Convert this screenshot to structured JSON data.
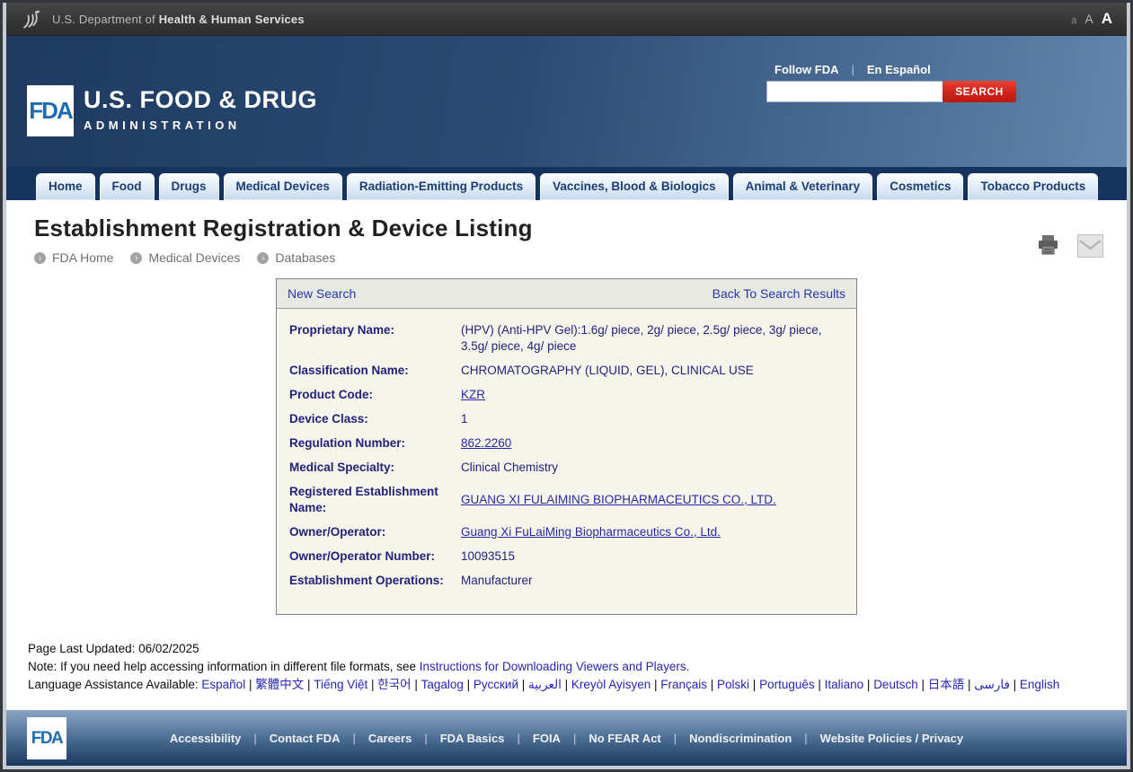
{
  "hhs_bar": {
    "dept_prefix": "U.S. Department of",
    "dept_bold": "Health & Human Services",
    "font_size_controls": [
      "a",
      "A",
      "A"
    ]
  },
  "header": {
    "logo_text": "FDA",
    "brand_line1": "U.S. FOOD & DRUG",
    "brand_line2": "ADMINISTRATION",
    "follow_fda": "Follow FDA",
    "separator": "|",
    "en_espanol": "En Español",
    "search_placeholder": "",
    "search_value": "",
    "search_button": "SEARCH"
  },
  "nav": {
    "tabs": [
      "Home",
      "Food",
      "Drugs",
      "Medical Devices",
      "Radiation-Emitting Products",
      "Vaccines, Blood & Biologics",
      "Animal & Veterinary",
      "Cosmetics",
      "Tobacco Products"
    ]
  },
  "page": {
    "title": "Establishment Registration & Device Listing",
    "breadcrumb": [
      "FDA Home",
      "Medical Devices",
      "Databases"
    ]
  },
  "result_box": {
    "new_search": "New Search",
    "back_to_results": "Back To Search Results",
    "rows": [
      {
        "label": "Proprietary Name:",
        "value": "(HPV) (Anti-HPV Gel):1.6g/ piece, 2g/ piece, 2.5g/ piece, 3g/ piece, 3.5g/ piece, 4g/ piece",
        "is_link": false
      },
      {
        "label": "Classification Name:",
        "value": "CHROMATOGRAPHY (LIQUID, GEL), CLINICAL USE",
        "is_link": false
      },
      {
        "label": "Product Code:",
        "value": "KZR",
        "is_link": true
      },
      {
        "label": "Device Class:",
        "value": "1",
        "is_link": false
      },
      {
        "label": "Regulation Number:",
        "value": "862.2260",
        "is_link": true
      },
      {
        "label": "Medical Specialty:",
        "value": "Clinical Chemistry",
        "is_link": false
      },
      {
        "label": "Registered Establishment Name:",
        "value": "GUANG XI FULAIMING BIOPHARMACEUTICS CO., LTD.",
        "is_link": true
      },
      {
        "label": "Owner/Operator:",
        "value": "Guang Xi FuLaiMing Biopharmaceutics Co., Ltd.",
        "is_link": true
      },
      {
        "label": "Owner/Operator Number:",
        "value": "10093515",
        "is_link": false
      },
      {
        "label": "Establishment Operations:",
        "value": "Manufacturer",
        "is_link": false
      }
    ]
  },
  "notes": {
    "last_updated": "Page Last Updated: 06/02/2025",
    "note_prefix": "Note: If you need help accessing information in different file formats, see ",
    "note_link": "Instructions for Downloading Viewers and Players.",
    "language_label": "Language Assistance Available: ",
    "languages": [
      "Español",
      "繁體中文",
      "Tiếng Việt",
      "한국어",
      "Tagalog",
      "Русский",
      "العربية",
      "Kreyòl Ayisyen",
      "Français",
      "Polski",
      "Português",
      "Italiano",
      "Deutsch",
      "日本語",
      "فارسی",
      "English"
    ]
  },
  "footer": {
    "logo_text": "FDA",
    "links": [
      "Accessibility",
      "Contact FDA",
      "Careers",
      "FDA Basics",
      "FOIA",
      "No FEAR Act",
      "Nondiscrimination",
      "Website Policies / Privacy"
    ]
  },
  "colors": {
    "header_navy": "#1e3a62",
    "nav_navy": "#16335f",
    "search_red": "#d7261d",
    "link_blue": "#2a28a8",
    "detail_navy": "#23217b",
    "footer_gradient_top": "#8aa5c3",
    "footer_gradient_bottom": "#1a3860"
  }
}
